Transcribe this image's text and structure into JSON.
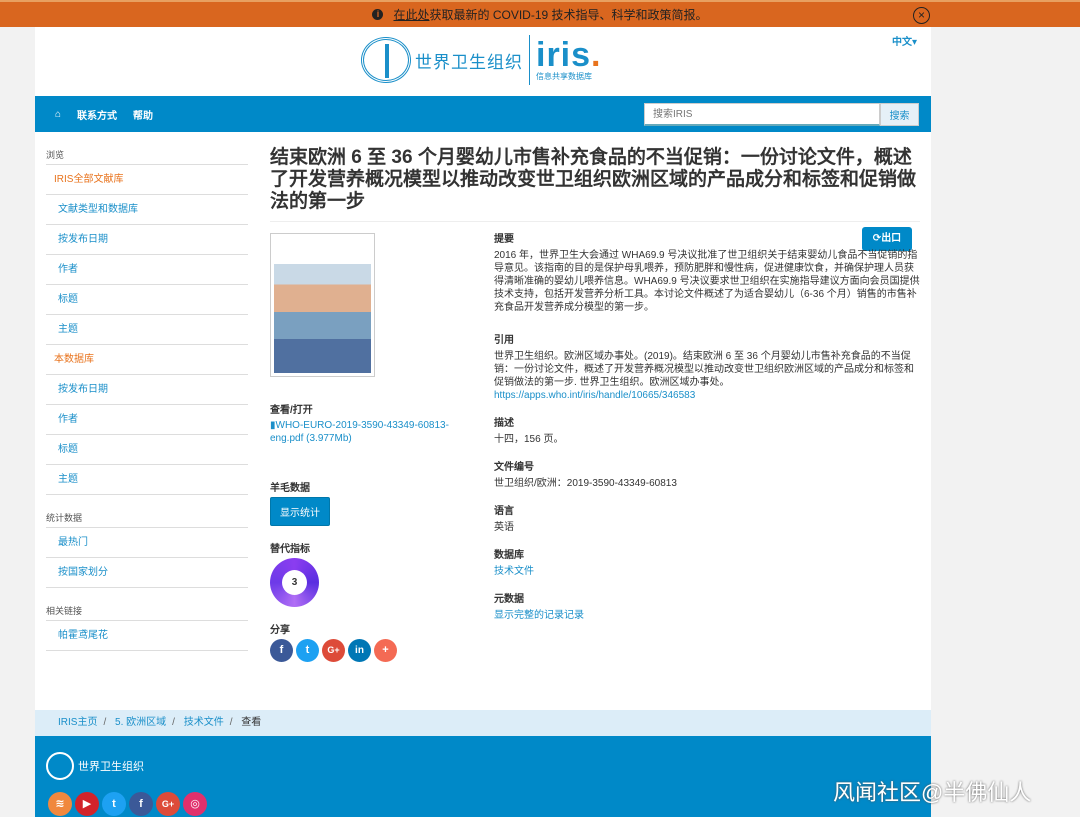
{
  "banner": {
    "link": "在此处",
    "text": "获取最新的 COVID-19 技术指导、科学和政策简报。"
  },
  "header": {
    "org": "世界卫生组织",
    "brand": "iris",
    "brand_dot": ".",
    "brand_sub": "信息共享数据库",
    "lang": "中文▾"
  },
  "nav": {
    "items": [
      "联系方式",
      "帮助"
    ],
    "search_placeholder": "搜索IRIS",
    "search_button": "搜索"
  },
  "sidebar": {
    "browse": "浏览",
    "all": "IRIS全部文献库",
    "all_items": [
      "文献类型和数据库",
      "按发布日期",
      "作者",
      "标题",
      "主题"
    ],
    "this": "本数据库",
    "this_items": [
      "按发布日期",
      "作者",
      "标题",
      "主题"
    ],
    "stats": "统计数据",
    "stats_items": [
      "最热门",
      "按国家划分"
    ],
    "links": "相关链接",
    "links_items": [
      "帕霍鸢尾花"
    ]
  },
  "title": "结束欧洲 6 至 36 个月婴幼儿市售补充食品的不当促销：一份讨论文件，概述了开发营养概况模型以推动改变世卫组织欧洲区域的产品成分和标签和促销做法的第一步",
  "left": {
    "view_label": "查看/打开",
    "file": "WHO-EURO-2019-3590-43349-60813-eng.pdf (3.977Mb)",
    "sheep_label": "羊毛数据",
    "stats_button": "显示统计",
    "alt_label": "替代指标",
    "alt_score": "3",
    "share_label": "分享"
  },
  "export": "出口",
  "right": {
    "abstract_label": "提要",
    "abstract": "2016 年，世界卫生大会通过 WHA69.9 号决议批准了世卫组织关于结束婴幼儿食品不当促销的指导意见。该指南的目的是保护母乳喂养，预防肥胖和慢性病，促进健康饮食，并确保护理人员获得清晰准确的婴幼儿喂养信息。WHA69.9 号决议要求世卫组织在实施指导建议方面向会员国提供技术支持，包括开发营养分析工具。本讨论文件概述了为适合婴幼儿（6-36 个月）销售的市售补充食品开发营养成分模型的第一步。",
    "cite_label": "引用",
    "cite": "世界卫生组织。欧洲区域办事处。(2019)。结束欧洲 6 至 36 个月婴幼儿市售补充食品的不当促销：一份讨论文件，概述了开发营养概况模型以推动改变世卫组织欧洲区域的产品成分和标签和促销做法的第一步. 世界卫生组织。欧洲区域办事处。",
    "cite_url": "https://apps.who.int/iris/handle/10665/346583",
    "desc_label": "描述",
    "desc": "十四，156 页。",
    "docno_label": "文件编号",
    "docno": "世卫组织/欧洲：2019-3590-43349-60813",
    "lang_label": "语言",
    "lang": "英语",
    "db_label": "数据库",
    "db": "技术文件",
    "meta_label": "元数据",
    "meta": "显示完整的记录记录"
  },
  "breadcrumb": [
    "IRIS主页",
    "5. 欧洲区域",
    "技术文件",
    "查看"
  ],
  "footer": {
    "org": "世界卫生组织"
  },
  "watermark": "风闻社区@半佛仙人"
}
